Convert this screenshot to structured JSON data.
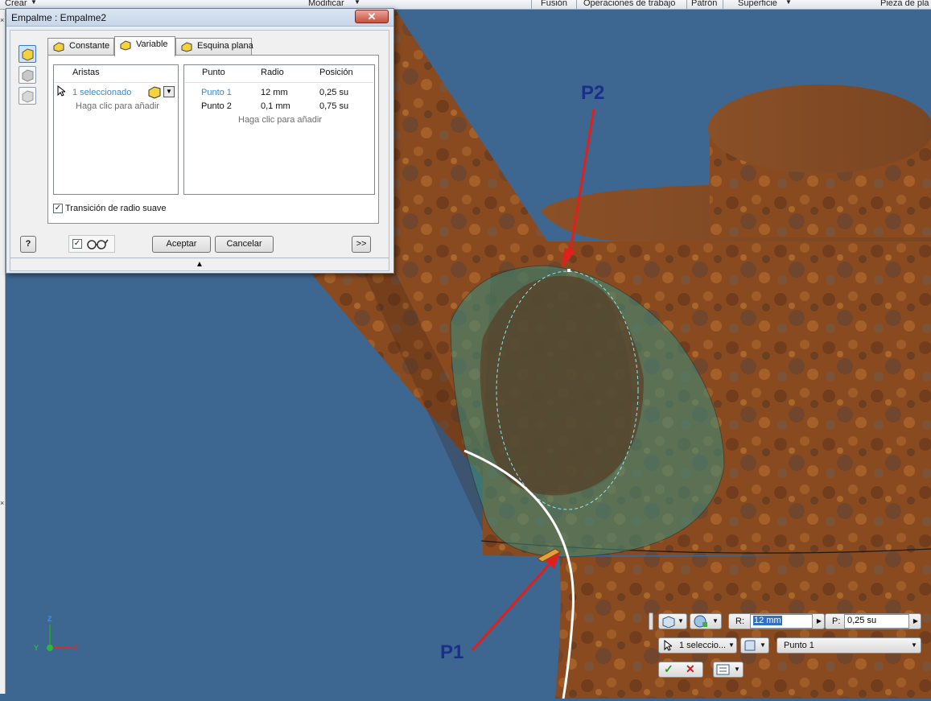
{
  "ribbon": {
    "items": [
      "Crear",
      "Modificar",
      "Fusión",
      "Operaciones de trabajo",
      "Patrón",
      "Superficie",
      "Pieza de pla"
    ]
  },
  "dialog": {
    "title": "Empalme : Empalme2",
    "close_label": "✕",
    "tabs": [
      {
        "label": "Constante"
      },
      {
        "label": "Variable"
      },
      {
        "label": "Esquina plana"
      }
    ],
    "edges": {
      "header": "Aristas",
      "selected": "1 seleccionado",
      "add_hint": "Haga clic para añadir"
    },
    "points_table": {
      "headers": [
        "Punto",
        "Radio",
        "Posición"
      ],
      "rows": [
        {
          "point": "Punto 1",
          "radius": "12 mm",
          "position": "0,25 su"
        },
        {
          "point": "Punto 2",
          "radius": "0,1 mm",
          "position": "0,75 su"
        }
      ],
      "add_hint": "Haga clic para añadir"
    },
    "smooth_transition_label": "Transición de radio suave",
    "help_label": "?",
    "ok_label": "Aceptar",
    "cancel_label": "Cancelar",
    "more_label": ">>",
    "expand_label": "▲"
  },
  "annotations": {
    "p1": "P1",
    "p2": "P2"
  },
  "minitoolbar": {
    "r_label": "R:",
    "r_value": "12 mm",
    "p_label": "P:",
    "p_value": "0,25 su",
    "selection_value": "1 seleccio...",
    "point_value": "Punto 1"
  },
  "axes": {
    "x": "X",
    "y": "Y",
    "z": "Z"
  },
  "colors": {
    "background": "#3d6690",
    "rust": "#8a4a1f",
    "fillet_preview": "#3f8a78",
    "arrow": "#e0201c",
    "annotation_text": "#1a2f8a"
  }
}
